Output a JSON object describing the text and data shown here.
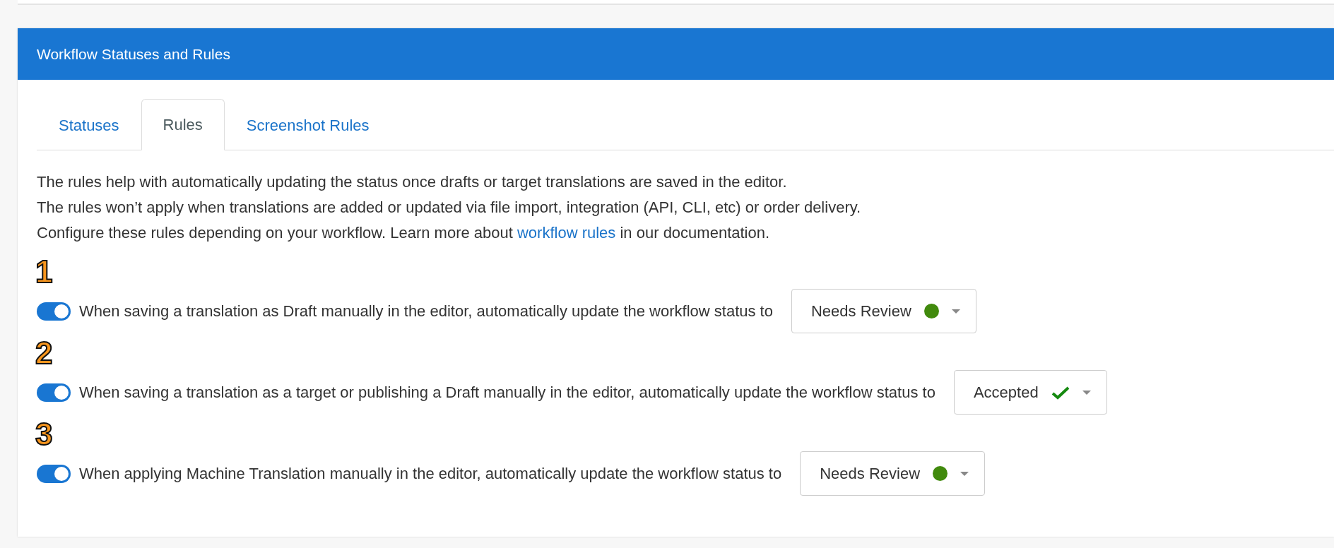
{
  "panel": {
    "title": "Workflow Statuses and Rules"
  },
  "tabs": [
    {
      "label": "Statuses",
      "selected": false
    },
    {
      "label": "Rules",
      "selected": true
    },
    {
      "label": "Screenshot Rules",
      "selected": false
    }
  ],
  "intro": [
    {
      "text": "The rules help with automatically updating the status once drafts or target translations are saved in the editor."
    },
    {
      "text": "The rules won’t apply when translations are added or updated via file import, integration (API, CLI, etc) or order delivery."
    },
    {
      "text": "Configure these rules depending on your workflow. Learn more about",
      "link": "workflow rules",
      "after": "in our documentation."
    }
  ],
  "rules": [
    {
      "number": "1",
      "on": true,
      "text": "When saving a translation as Draft manually in the editor, automatically update the workflow status to",
      "status": {
        "label": "Needs Review",
        "kind": "dot",
        "color": "#418a0d"
      }
    },
    {
      "number": "2",
      "on": true,
      "text": "When saving a translation as a target or publishing a Draft manually in the editor, automatically update the workflow status to",
      "status": {
        "label": "Accepted",
        "kind": "check",
        "color": "#15890f"
      }
    },
    {
      "number": "3",
      "on": true,
      "text": "When applying Machine Translation manually in the editor, automatically update the workflow status to",
      "status": {
        "label": "Needs Review",
        "kind": "dot",
        "color": "#418a0d"
      }
    }
  ]
}
